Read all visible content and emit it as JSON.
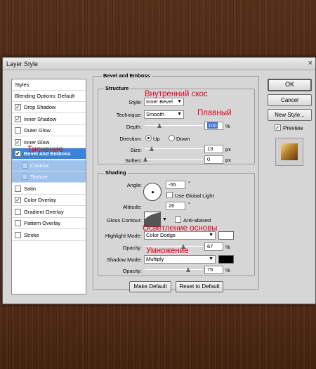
{
  "window": {
    "title": "Layer Style",
    "close_glyph": "×"
  },
  "styles_panel": {
    "header": "Styles",
    "blending_options": "Blending Options: Default",
    "items": [
      {
        "label": "Drop Shadow",
        "checked": true
      },
      {
        "label": "Inner Shadow",
        "checked": true
      },
      {
        "label": "Outer Glow",
        "checked": false
      },
      {
        "label": "Inner Glow",
        "checked": true
      },
      {
        "label": "Bevel and Emboss",
        "checked": true,
        "selected": true
      },
      {
        "label": "Contour",
        "checked": false,
        "sub": true
      },
      {
        "label": "Texture",
        "checked": false,
        "sub": true
      },
      {
        "label": "Satin",
        "checked": false
      },
      {
        "label": "Color Overlay",
        "checked": true
      },
      {
        "label": "Gradient Overlay",
        "checked": false
      },
      {
        "label": "Pattern Overlay",
        "checked": false
      },
      {
        "label": "Stroke",
        "checked": false
      }
    ]
  },
  "bevel": {
    "group_title": "Bevel and Emboss",
    "structure": {
      "title": "Structure",
      "style_label": "Style:",
      "style_value": "Inner Bevel",
      "technique_label": "Technique:",
      "technique_value": "Smooth",
      "depth_label": "Depth:",
      "depth_value": "100",
      "depth_unit": "%",
      "direction_label": "Direction:",
      "dir_up": "Up",
      "dir_down": "Down",
      "size_label": "Size:",
      "size_value": "13",
      "size_unit": "px",
      "soften_label": "Soften:",
      "soften_value": "0",
      "soften_unit": "px"
    },
    "shading": {
      "title": "Shading",
      "angle_label": "Angle:",
      "angle_value": "-55",
      "angle_unit": "°",
      "global_light": "Use Global Light",
      "altitude_label": "Altitude:",
      "altitude_value": "26",
      "altitude_unit": "°",
      "gloss_label": "Gloss Contour:",
      "anti_aliased": "Anti-aliased",
      "highlight_label": "Highlight Mode:",
      "highlight_value": "Color Dodge",
      "hl_opacity_label": "Opacity:",
      "hl_opacity_value": "67",
      "hl_opacity_unit": "%",
      "shadow_label": "Shadow Mode:",
      "shadow_value": "Multiply",
      "sh_opacity_label": "Opacity:",
      "sh_opacity_value": "75",
      "sh_opacity_unit": "%",
      "highlight_color": "#ffffff",
      "shadow_color": "#000000"
    },
    "make_default": "Make Default",
    "reset_default": "Reset to Default"
  },
  "buttons": {
    "ok": "OK",
    "cancel": "Cancel",
    "new_style": "New Style...",
    "preview": "Preview"
  },
  "annotations": {
    "inner_bevel_ru": "Внутренний скос",
    "smooth_ru": "Плавный",
    "emboss_ru": "Тиснение",
    "color_dodge_ru": "Осветление основы",
    "multiply_ru": "Умножение"
  },
  "colors": {
    "selection": "#3b82d6",
    "annotation": "#e0001b"
  }
}
